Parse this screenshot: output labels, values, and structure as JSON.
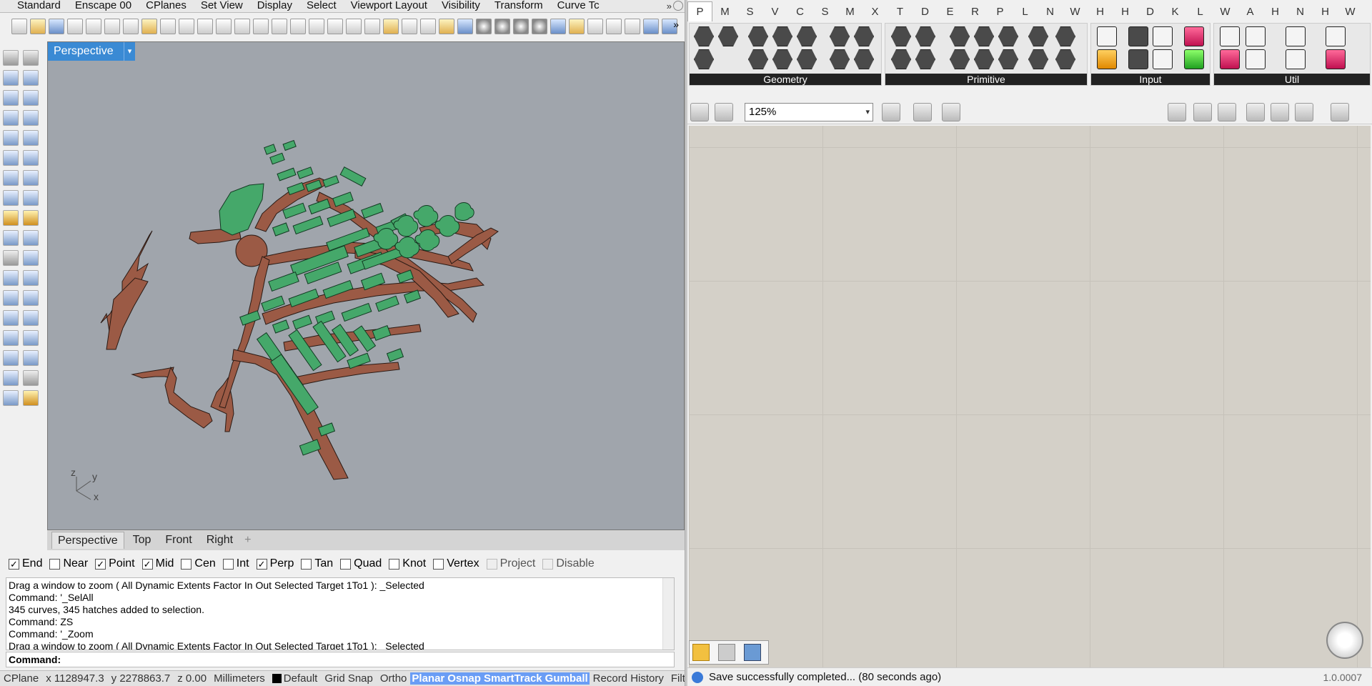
{
  "rhino": {
    "toolbar_tabs": [
      "Standard",
      "Enscape 00",
      "CPlanes",
      "Set View",
      "Display",
      "Select",
      "Viewport Layout",
      "Visibility",
      "Transform",
      "Curve Tc"
    ],
    "tab_overflow": "»",
    "viewport": {
      "title": "Perspective",
      "dropdown_glyph": "▾"
    },
    "axes": {
      "z": "z",
      "y": "y",
      "x": "x"
    },
    "view_tabs": [
      "Perspective",
      "Top",
      "Front",
      "Right"
    ],
    "view_tab_add": "+",
    "osnaps": [
      {
        "label": "End",
        "checked": true,
        "enabled": true
      },
      {
        "label": "Near",
        "checked": false,
        "enabled": true
      },
      {
        "label": "Point",
        "checked": true,
        "enabled": true
      },
      {
        "label": "Mid",
        "checked": true,
        "enabled": true
      },
      {
        "label": "Cen",
        "checked": false,
        "enabled": true
      },
      {
        "label": "Int",
        "checked": false,
        "enabled": true
      },
      {
        "label": "Perp",
        "checked": true,
        "enabled": true
      },
      {
        "label": "Tan",
        "checked": false,
        "enabled": true
      },
      {
        "label": "Quad",
        "checked": false,
        "enabled": true
      },
      {
        "label": "Knot",
        "checked": false,
        "enabled": true
      },
      {
        "label": "Vertex",
        "checked": false,
        "enabled": true
      },
      {
        "label": "Project",
        "checked": false,
        "enabled": false
      },
      {
        "label": "Disable",
        "checked": false,
        "enabled": false
      }
    ],
    "command_history": [
      "Drag a window to zoom ( All  Dynamic  Extents  Factor  In  Out  Selected  Target  1To1 ): _Selected",
      "Command: '_SelAll",
      "345 curves, 345 hatches added to selection.",
      "Command: ZS",
      "Command: '_Zoom",
      "Drag a window to zoom ( All  Dynamic  Extents  Factor  In  Out  Selected  Target  1To1 ): _Selected"
    ],
    "command_prompt": "Command:",
    "status": {
      "cplane": "CPlane",
      "x": "x 1128947.3",
      "y": "y 2278863.7",
      "z": "z 0.00",
      "units": "Millimeters",
      "layer": "Default",
      "items": [
        {
          "label": "Grid Snap",
          "highlight": false
        },
        {
          "label": "Ortho",
          "highlight": false
        },
        {
          "label": "Planar",
          "highlight": true
        },
        {
          "label": "Osnap",
          "highlight": true
        },
        {
          "label": "SmartTrack",
          "highlight": true
        },
        {
          "label": "Gumball",
          "highlight": true
        },
        {
          "label": "Record History",
          "highlight": false
        },
        {
          "label": "Filter",
          "highlight": false
        }
      ]
    },
    "colors": {
      "road": "#9b5a45",
      "building": "#45a86a",
      "viewport_bg": "#a0a5ac",
      "viewport_title": "#3a8ad4",
      "status_highlight": "#6a9df5"
    }
  },
  "gh": {
    "tabs": [
      "P",
      "M",
      "S",
      "V",
      "C",
      "S",
      "M",
      "X",
      "T",
      "D",
      "E",
      "R",
      "P",
      "L",
      "N",
      "W",
      "H",
      "H",
      "D",
      "K",
      "L",
      "W",
      "A",
      "H",
      "N",
      "H",
      "W"
    ],
    "active_tab": "P",
    "groups": [
      {
        "label": "Geometry"
      },
      {
        "label": "Primitive"
      },
      {
        "label": "Input"
      },
      {
        "label": "Util"
      }
    ],
    "zoom": "125%",
    "status_message": "Save successfully completed... (80 seconds ago)",
    "version": "1.0.0007"
  }
}
